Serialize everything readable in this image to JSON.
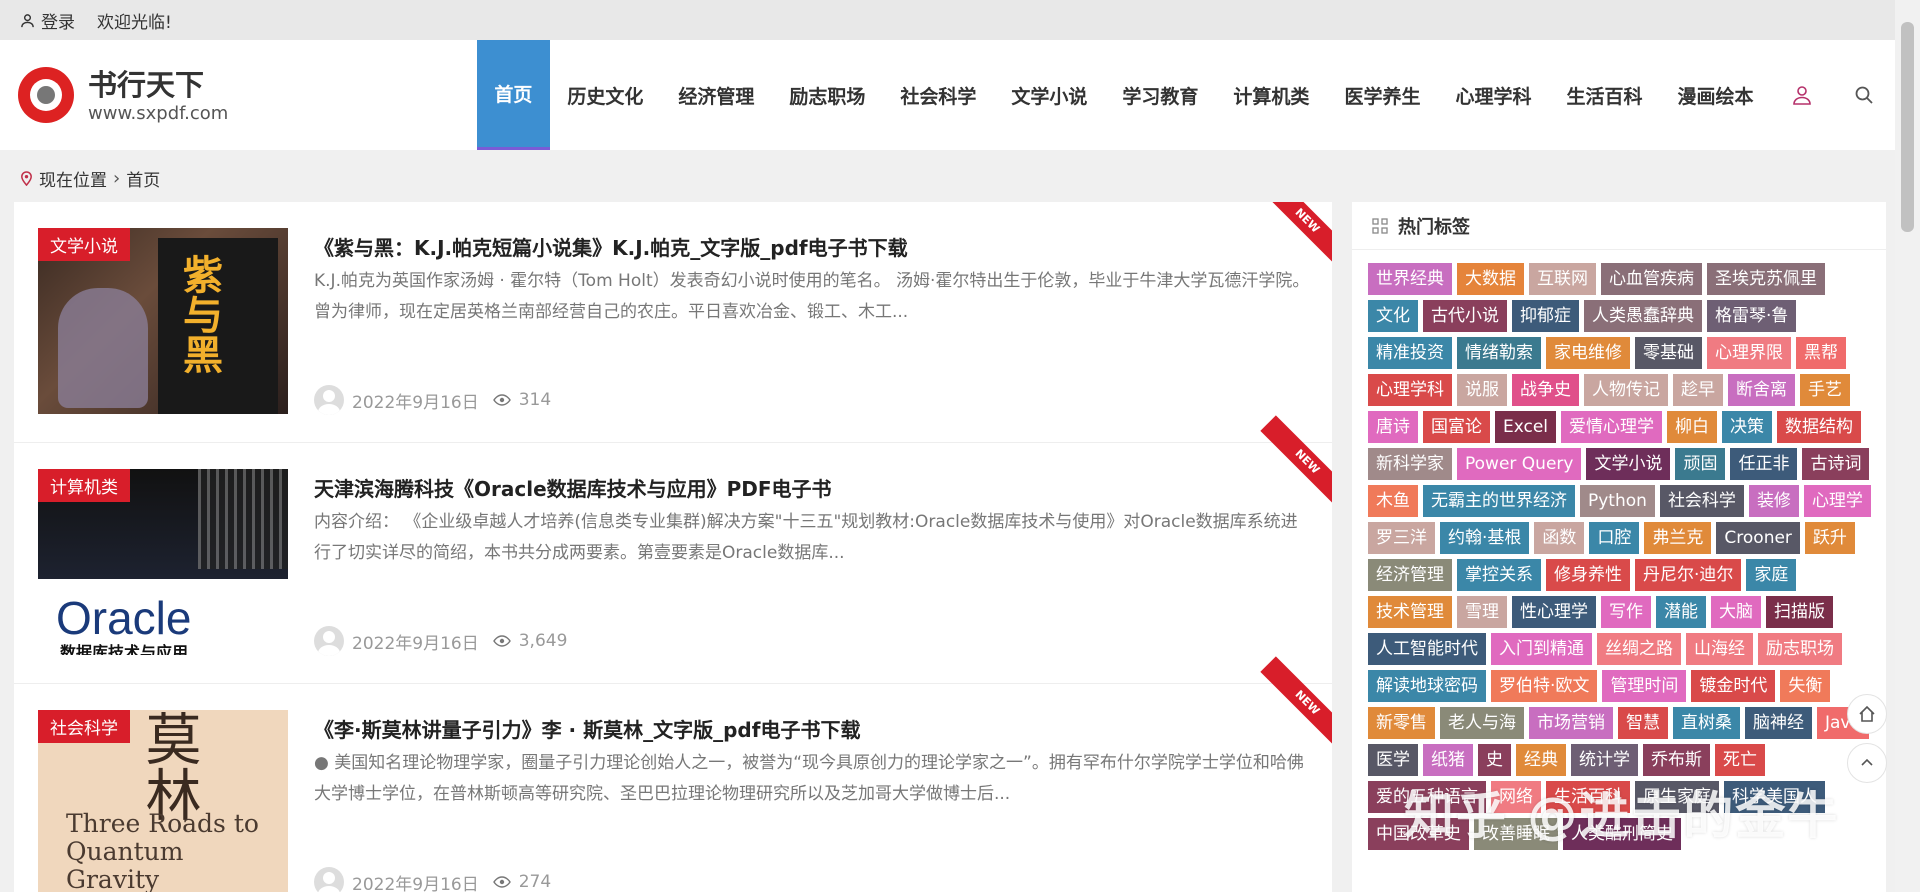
{
  "topbar": {
    "login": "登录",
    "welcome": "欢迎光临!"
  },
  "site": {
    "name": "书行天下",
    "url": "www.sxpdf.com",
    "accent": "#3d8fd1",
    "brand_red": "#d81e2a"
  },
  "nav": {
    "items": [
      "首页",
      "历史文化",
      "经济管理",
      "励志职场",
      "社会科学",
      "文学小说",
      "学习教育",
      "计算机类",
      "医学养生",
      "心理学科",
      "生活百科",
      "漫画绘本"
    ],
    "active": "首页"
  },
  "breadcrumb": {
    "label": "现在位置",
    "current": "首页"
  },
  "posts": [
    {
      "category": "文学小说",
      "title": "《紫与黑：K.J.帕克短篇小说集》K.J.帕克_文字版_pdf电子书下载",
      "excerpt": "K.J.帕克为英国作家汤姆 · 霍尔特（Tom Holt）发表奇幻小说时使用的笔名。 汤姆·霍尔特出生于伦敦，毕业于牛津大学瓦德汗学院。曾为律师，现在定居英格兰南部经营自己的农庄。平日喜欢冶金、锻工、木工...",
      "date": "2022年9月16日",
      "views": "314",
      "badge": "NEW",
      "cover_title": "紫与黑"
    },
    {
      "category": "计算机类",
      "title": "天津滨海腾科技《Oracle数据库技术与应用》PDF电子书",
      "excerpt": "内容介绍： 《企业级卓越人才培养(信息类专业集群)解决方案\"十三五\"规划教材:Oracle数据库技术与使用》对Oracle数据库系统进行了切实详尽的简绍，本书共分成两要素。第壹要素是Oracle数据库...",
      "date": "2022年9月16日",
      "views": "3,649",
      "badge": "NEW",
      "cover_title": "Oracle",
      "cover_sub": "数据库技术与应用"
    },
    {
      "category": "社会科学",
      "title": "《李·斯莫林讲量子引力》李 · 斯莫林_文字版_pdf电子书下载",
      "excerpt": "● 美国知名理论物理学家，圈量子引力理论创始人之一，被誉为“现今具原创力的理论学家之一”。拥有罕布什尔学院学士学位和哈佛大学博士学位，在普林斯顿高等研究院、圣巴巴拉理论物理研究所以及芝加哥大学做博士后...",
      "date": "2022年9月16日",
      "views": "274",
      "badge": "NEW",
      "cover_title": "莫林",
      "cover_sub": "Three Roads to Quantum Gravity"
    }
  ],
  "sidebar": {
    "title": "热门标签",
    "tags": [
      {
        "text": "世界经典",
        "color": "#c86ec0"
      },
      {
        "text": "大数据",
        "color": "#e5843b"
      },
      {
        "text": "互联网",
        "color": "#c9a6a0"
      },
      {
        "text": "心血管疾病",
        "color": "#8a6f78"
      },
      {
        "text": "圣埃克苏佩里",
        "color": "#8a6f78"
      },
      {
        "text": "文化",
        "color": "#3b87a8"
      },
      {
        "text": "古代小说",
        "color": "#8a3f5c"
      },
      {
        "text": "抑郁症",
        "color": "#3d5b7a"
      },
      {
        "text": "人类愚蠢辞典",
        "color": "#8a6f78"
      },
      {
        "text": "格雷琴·鲁",
        "color": "#6e5f74"
      },
      {
        "text": "精准投资",
        "color": "#3b87a8"
      },
      {
        "text": "情绪勒索",
        "color": "#3b7a8f"
      },
      {
        "text": "家电维修",
        "color": "#e08a3a"
      },
      {
        "text": "零基础",
        "color": "#585866"
      },
      {
        "text": "心理界限",
        "color": "#f07b82"
      },
      {
        "text": "黑帮",
        "color": "#f06b6b"
      },
      {
        "text": "心理学科",
        "color": "#d94a4a"
      },
      {
        "text": "说服",
        "color": "#c9a6a0"
      },
      {
        "text": "战争史",
        "color": "#e0508a"
      },
      {
        "text": "人物传记",
        "color": "#c9a6a0"
      },
      {
        "text": "趁早",
        "color": "#c9a6a0"
      },
      {
        "text": "断舍离",
        "color": "#c86ec0"
      },
      {
        "text": "手艺",
        "color": "#e08a3a"
      },
      {
        "text": "唐诗",
        "color": "#e06abf"
      },
      {
        "text": "国富论",
        "color": "#d94a4a"
      },
      {
        "text": "Excel",
        "color": "#7a2e4a"
      },
      {
        "text": "爱情心理学",
        "color": "#e06abf"
      },
      {
        "text": "柳白",
        "color": "#e08a3a"
      },
      {
        "text": "决策",
        "color": "#3b87a8"
      },
      {
        "text": "数据结构",
        "color": "#d94a4a"
      },
      {
        "text": "新科学家",
        "color": "#a08a8a"
      },
      {
        "text": "Power Query",
        "color": "#e06abf"
      },
      {
        "text": "文学小说",
        "color": "#6e2e5a"
      },
      {
        "text": "顽固",
        "color": "#3b7a8f"
      },
      {
        "text": "任正非",
        "color": "#3d5b7a"
      },
      {
        "text": "古诗词",
        "color": "#8a3f5c"
      },
      {
        "text": "木鱼",
        "color": "#f07a5a"
      },
      {
        "text": "无霸主的世界经济",
        "color": "#3b87a8"
      },
      {
        "text": "Python",
        "color": "#a08a8a"
      },
      {
        "text": "社会科学",
        "color": "#585866"
      },
      {
        "text": "装修",
        "color": "#c86ec0"
      },
      {
        "text": "心理学",
        "color": "#e06abf"
      },
      {
        "text": "罗三洋",
        "color": "#c9a6a0"
      },
      {
        "text": "约翰·基根",
        "color": "#3b87a8"
      },
      {
        "text": "函数",
        "color": "#c9a6a0"
      },
      {
        "text": "口腔",
        "color": "#3b87a8"
      },
      {
        "text": "弗兰克",
        "color": "#e08a3a"
      },
      {
        "text": "Crooner",
        "color": "#585866"
      },
      {
        "text": "跃升",
        "color": "#e08a3a"
      },
      {
        "text": "经济管理",
        "color": "#8a8a78"
      },
      {
        "text": "掌控关系",
        "color": "#3b87a8"
      },
      {
        "text": "修身养性",
        "color": "#d94a4a"
      },
      {
        "text": "丹尼尔·迪尔",
        "color": "#d94a4a"
      },
      {
        "text": "家庭",
        "color": "#3b87a8"
      },
      {
        "text": "技术管理",
        "color": "#e08a3a"
      },
      {
        "text": "雪理",
        "color": "#c9a6a0"
      },
      {
        "text": "性心理学",
        "color": "#3d5b7a"
      },
      {
        "text": "写作",
        "color": "#e06abf"
      },
      {
        "text": "潜能",
        "color": "#3b87a8"
      },
      {
        "text": "大脑",
        "color": "#e06abf"
      },
      {
        "text": "扫描版",
        "color": "#7a2e4a"
      },
      {
        "text": "人工智能时代",
        "color": "#3d5b7a"
      },
      {
        "text": "入门到精通",
        "color": "#e06abf"
      },
      {
        "text": "丝绸之路",
        "color": "#f07b82"
      },
      {
        "text": "山海经",
        "color": "#f07b82"
      },
      {
        "text": "励志职场",
        "color": "#f07b82"
      },
      {
        "text": "解读地球密码",
        "color": "#3b87a8"
      },
      {
        "text": "罗伯特·欧文",
        "color": "#f07a5a"
      },
      {
        "text": "管理时间",
        "color": "#e06abf"
      },
      {
        "text": "镀金时代",
        "color": "#d94a4a"
      },
      {
        "text": "失衡",
        "color": "#f07a5a"
      },
      {
        "text": "新零售",
        "color": "#e08a3a"
      },
      {
        "text": "老人与海",
        "color": "#8a8a78"
      },
      {
        "text": "市场营销",
        "color": "#c86ec0"
      },
      {
        "text": "智慧",
        "color": "#d94a4a"
      },
      {
        "text": "直树桑",
        "color": "#3b87a8"
      },
      {
        "text": "脑神经",
        "color": "#3d5b7a"
      },
      {
        "text": "Java",
        "color": "#f06b6b"
      },
      {
        "text": "医学",
        "color": "#585866"
      },
      {
        "text": "纸猪",
        "color": "#c86ec0"
      },
      {
        "text": "史",
        "color": "#8a3f5c"
      },
      {
        "text": "经典",
        "color": "#e08a3a"
      },
      {
        "text": "统计学",
        "color": "#6e5f74"
      },
      {
        "text": "乔布斯",
        "color": "#8a3f5c"
      },
      {
        "text": "死亡",
        "color": "#d94a4a"
      },
      {
        "text": "爱的五种语言",
        "color": "#8a3f5c"
      },
      {
        "text": "网络",
        "color": "#f07b82"
      },
      {
        "text": "生活百科",
        "color": "#d94a4a"
      },
      {
        "text": "原生家庭",
        "color": "#585866"
      },
      {
        "text": "科学美国人",
        "color": "#3d5b7a"
      },
      {
        "text": "中国改革史",
        "color": "#8a3f5c"
      },
      {
        "text": "改善睡眠",
        "color": "#8a8a78"
      },
      {
        "text": "人类酷刑简史",
        "color": "#6e2e5a"
      }
    ]
  },
  "watermark": "知乎 @进击的金牛"
}
